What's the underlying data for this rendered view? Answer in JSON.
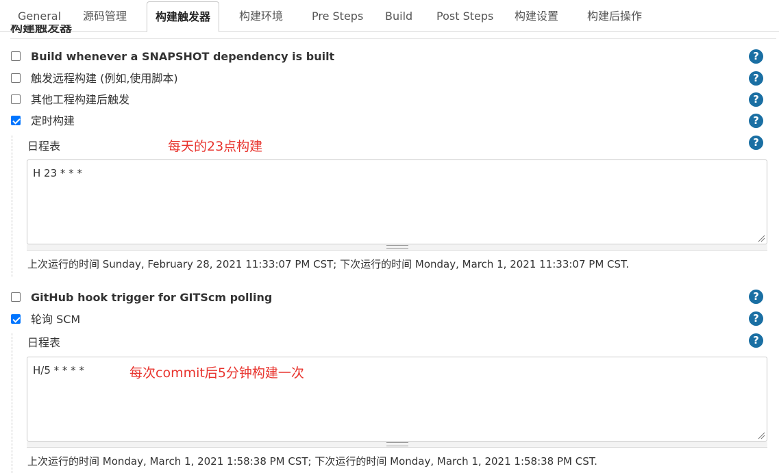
{
  "tabs": [
    {
      "label": "General"
    },
    {
      "label": "源码管理"
    },
    {
      "label": "构建触发器"
    },
    {
      "label": "构建环境"
    },
    {
      "label": "Pre Steps"
    },
    {
      "label": "Build"
    },
    {
      "label": "Post Steps"
    },
    {
      "label": "构建设置"
    },
    {
      "label": "构建后操作"
    }
  ],
  "active_tab": "构建触发器",
  "section_title": "构建触发器",
  "help_glyph": "?",
  "triggers": [
    {
      "label": "Build whenever a SNAPSHOT dependency is built",
      "checked": false
    },
    {
      "label": "触发远程构建 (例如,使用脚本)",
      "checked": false
    },
    {
      "label": "其他工程构建后触发",
      "checked": false
    },
    {
      "label": "定时构建",
      "checked": true
    },
    {
      "label": "GitHub hook trigger for GITScm polling",
      "checked": false
    },
    {
      "label": "轮询 SCM",
      "checked": true
    }
  ],
  "timer": {
    "schedule_label": "日程表",
    "schedule_value": "H 23 * * *",
    "annotation": "每天的23点构建",
    "run_info": "上次运行的时间 Sunday, February 28, 2021 11:33:07 PM CST; 下次运行的时间 Monday, March 1, 2021 11:33:07 PM CST."
  },
  "poll_scm": {
    "schedule_label": "日程表",
    "schedule_value": "H/5 * * * *",
    "annotation": "每次commit后5分钟构建一次",
    "run_info": "上次运行的时间 Monday, March 1, 2021 1:58:38 PM CST; 下次运行的时间 Monday, March 1, 2021 1:58:38 PM CST."
  },
  "colors": {
    "accent": "#0075ff",
    "help": "#1a6fa3",
    "annotation": "#e8342e"
  }
}
